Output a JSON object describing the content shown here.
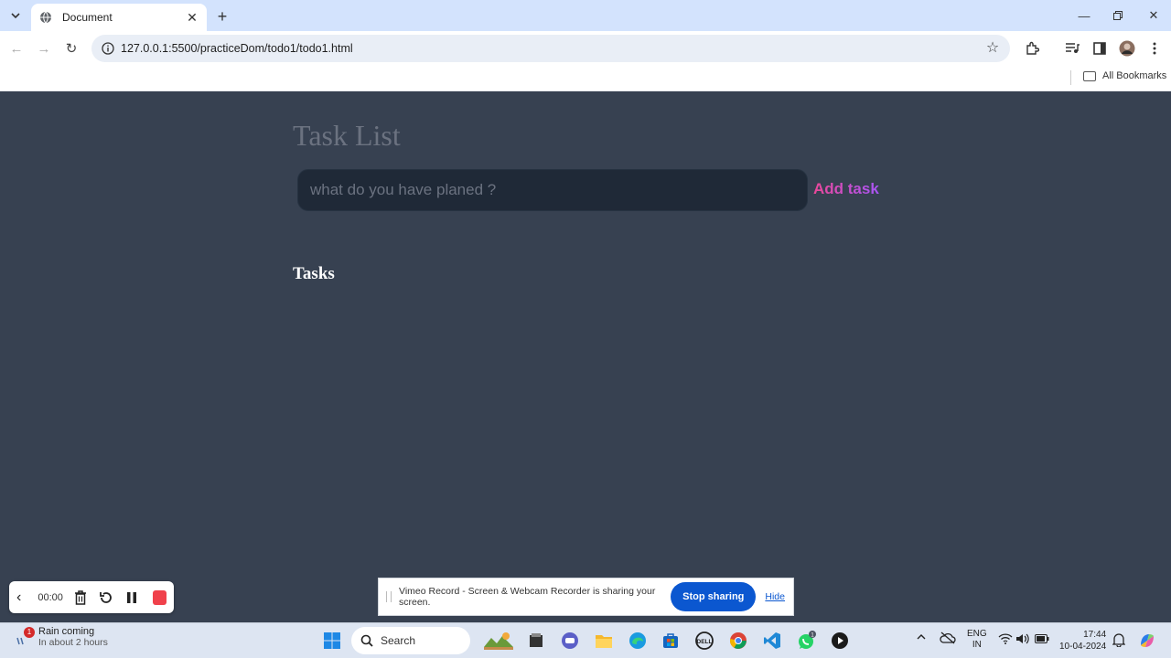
{
  "browser": {
    "tab_title": "Document",
    "url": "127.0.0.1:5500/practiceDom/todo1/todo1.html",
    "bookmarks_label": "All Bookmarks"
  },
  "page": {
    "title": "Task List",
    "input_placeholder": "what do you have planed ?",
    "add_button": "Add task",
    "tasks_heading": "Tasks"
  },
  "recorder": {
    "time": "00:00"
  },
  "sharebar": {
    "message": "Vimeo Record - Screen & Webcam Recorder is sharing your screen.",
    "stop_button": "Stop sharing",
    "hide_link": "Hide"
  },
  "taskbar": {
    "weather_title": "Rain coming",
    "weather_subtitle": "In about 2 hours",
    "weather_badge": "1",
    "search_label": "Search",
    "whatsapp_badge": "1",
    "lang_line1": "ENG",
    "lang_line2": "IN",
    "time": "17:44",
    "date": "10-04-2024"
  },
  "colors": {
    "page_bg": "#374151",
    "input_bg": "#1f2937",
    "accent_from": "#ec4899",
    "accent_to": "#a855f7",
    "chrome_blue": "#0b57d0",
    "record_red": "#f0414b"
  }
}
